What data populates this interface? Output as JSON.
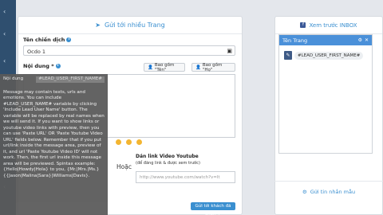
{
  "sidebar": {
    "arrows": [
      "‹",
      "‹",
      "‹",
      "‹",
      "‹"
    ]
  },
  "left_panel": {
    "title": "Gửi tới nhiều Trang",
    "campaign_label": "Tên chiến dịch",
    "campaign_value": "Ocdo 1",
    "content_label": "Nội dung *",
    "btn_name": "Bao gồm \"Tên\"",
    "btn_surname": "Bao gồm \"Họ\"",
    "youtube_title": "Dán link Video Youtube",
    "youtube_sub": "(để đăng link & được xem trước)",
    "or_label": "Hoặc",
    "youtube_placeholder": "http://www.youtube.com/watch?v=lt",
    "send_button": "Gửi tới khách đã chọn ↑"
  },
  "tooltip": {
    "title": "Nội dung",
    "code": "#LEAD_USER_FIRST_NAME#",
    "body": "Message may contain texts, urls and emotions. You can include #LEAD_USER_NAME# variable by clicking 'Include Lead User Name' button. The variable will be replaced by real names when we will send it. If you want to show links or youtube video links with preview, then you can use 'Paste URL' OR 'Paste Youtube Video URL' fields below. Remember that if you put url/link inside the message area, preview of it, and url 'Paste Youtube Video ID' will not work. Then, the first url inside this message area will be previewed. Spintax example: {Hello|Howdy|Hola} to you, {Mr.|Mrs.|Ms.} {{Jason|Malina|Sara}|Williams|Davis}."
  },
  "right_panel": {
    "title": "Xem trước INBOX",
    "chat_title": "Tên Trang",
    "chat_message": "#LEAD_USER_FIRST_NAME#",
    "footer": "Gửi tin nhắn mẫu"
  },
  "colors": {
    "accent": "#3a8fd0",
    "sidebar": "#2f4f6f",
    "tooltip": "#5a5a5a"
  }
}
